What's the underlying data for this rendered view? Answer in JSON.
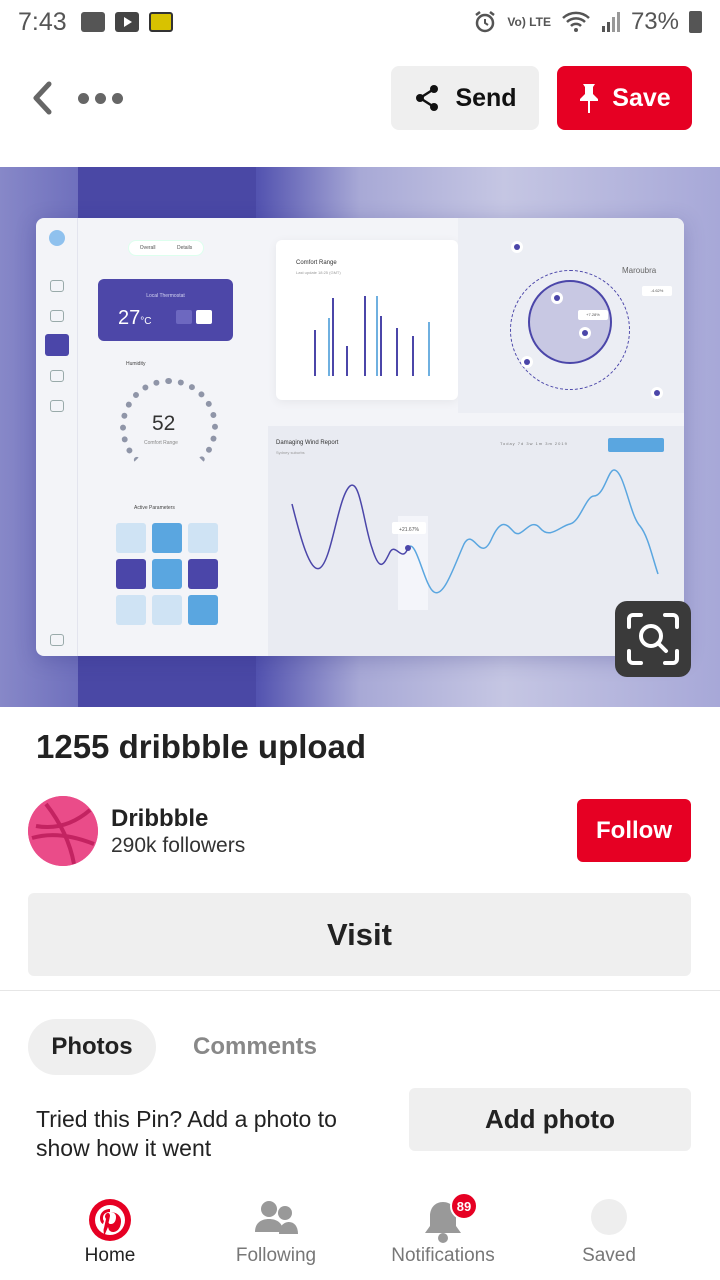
{
  "status_bar": {
    "time": "7:43",
    "lte_label": "Vo) LTE",
    "battery": "73%"
  },
  "actionbar": {
    "back_icon": "chevron-left-icon",
    "more_icon": "more-horizontal-icon",
    "send_label": "Send",
    "save_label": "Save"
  },
  "pin_image": {
    "dashboard": {
      "segment": [
        "Overall",
        "Details"
      ],
      "thermostat_label": "Local Thermostat",
      "thermostat_temp": "27",
      "thermostat_unit": "°C",
      "humidity_label": "Humidity",
      "humidity_value": "52",
      "humidity_sub": "Comfort Range",
      "params_label": "Active Parameters",
      "comfort_title": "Comfort Range",
      "comfort_sub": "Last update 18:25 (GMT)",
      "map_label": "Maroubra",
      "map_tags": [
        "-4.62%",
        "+7.28%"
      ],
      "wind_title": "Damaging Wind Report",
      "wind_sub": "Sydney suburbs",
      "wind_tabs": "Today  7d  3w  1m  3m  2019",
      "wind_point_label": "+21.67%"
    }
  },
  "pin": {
    "title": "1255 dribbble upload"
  },
  "creator": {
    "name": "Dribbble",
    "followers": "290k followers",
    "follow_label": "Follow"
  },
  "visit_label": "Visit",
  "tabs": {
    "photos": "Photos",
    "comments": "Comments"
  },
  "tried": {
    "text": "Tried this Pin? Add a photo to show how it went",
    "button": "Add photo"
  },
  "bottom_nav": {
    "home": "Home",
    "following": "Following",
    "notifications": "Notifications",
    "notifications_badge": "89",
    "saved": "Saved"
  },
  "colors": {
    "brand_red": "#e60023",
    "dashboard_purple": "#4b46a9",
    "dribbble_pink": "#ea4c89"
  }
}
